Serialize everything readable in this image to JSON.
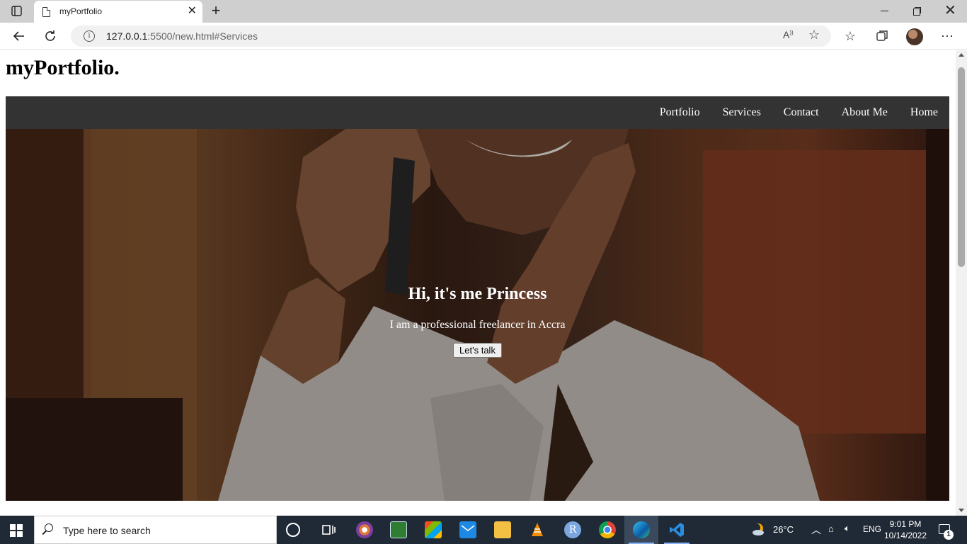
{
  "browser": {
    "tab_title": "myPortfolio",
    "url_host": "127.0.0.1",
    "url_rest": ":5500/new.html#Services"
  },
  "page": {
    "site_title": "myPortfolio.",
    "nav": [
      "Portfolio",
      "Services",
      "Contact",
      "About Me",
      "Home"
    ],
    "hero": {
      "heading": "Hi, it's me Princess",
      "subtitle": "I am a professional freelancer in Accra",
      "button": "Let's talk"
    }
  },
  "taskbar": {
    "search_placeholder": "Type here to search",
    "weather": "26°C",
    "language": "ENG",
    "time": "9:01 PM",
    "date": "10/14/2022",
    "notification_count": "1"
  }
}
